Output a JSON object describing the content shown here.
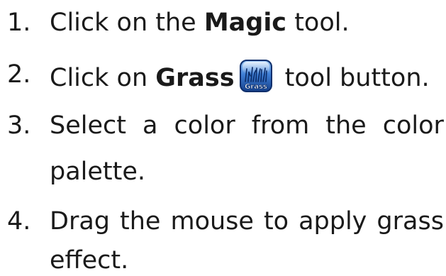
{
  "steps": [
    {
      "number": "1.",
      "pre": "Click on the ",
      "bold": "Magic",
      "post": " tool."
    },
    {
      "number": "2.",
      "pre": "Click on ",
      "bold": "Grass",
      "post": " tool button.",
      "icon": {
        "name": "grass-tool-icon",
        "label": "Grass",
        "colors": {
          "light": "#7fb4f0",
          "dark": "#1d4f9e",
          "blades": "#0a2a66"
        }
      }
    },
    {
      "number": "3.",
      "words": [
        "Select",
        "a",
        "color",
        "from",
        "the",
        "color"
      ],
      "continuation": "palette."
    },
    {
      "number": "4.",
      "words": [
        "Drag",
        "the",
        "mouse",
        "to",
        "apply",
        "grass"
      ],
      "continuation": "effect."
    }
  ]
}
